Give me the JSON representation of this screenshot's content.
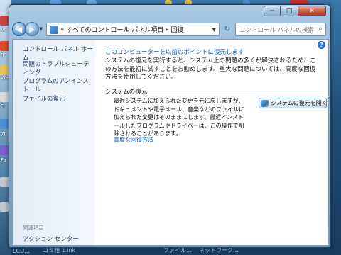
{
  "window": {
    "caption": {
      "minimize": "─",
      "maximize": "□",
      "close": "✕"
    }
  },
  "address_bar": {
    "prefix": "«",
    "segment_1": "すべてのコントロール パネル項目",
    "separator": "▸",
    "segment_2": "回復"
  },
  "search": {
    "placeholder": "コントロール パネルの検索"
  },
  "left_pane": {
    "home": "コントロール パネル ホーム",
    "items": [
      "問題のトラブルシューティング",
      "プログラムのアンインストール",
      "ファイルの復元"
    ],
    "related_title": "関連項目",
    "action_center": "アクション センター"
  },
  "main": {
    "restore_point_link": "このコンピューターを以前のポイントに復元します",
    "description": "システムの復元を実行すると、システム上の問題の多くが解決されるため、この方法を最初に試すことをお勧めします。重大な問題については、高度な回復方法を使用してください。",
    "section_title": "システムの復元",
    "section_description": "最近システムに加えられた変更を元に戻しますが、ドキュメントや電子メール、音楽などのファイルに加えられた変更はそのままにします。最近インストールしたプログラムやドライバーは、この操作で削除されることがあります。",
    "open_restore_button": "システムの復元を開く",
    "advanced_link": "高度な回復方法"
  },
  "desktop": {
    "left_labels": [
      "Ac",
      "R",
      "We",
      "Fi",
      "カ",
      "Fa"
    ],
    "bottom_labels": [
      "LCD...",
      "ゴミ箱 1.lnk",
      "ファイル...",
      "ネットワーク..."
    ]
  }
}
